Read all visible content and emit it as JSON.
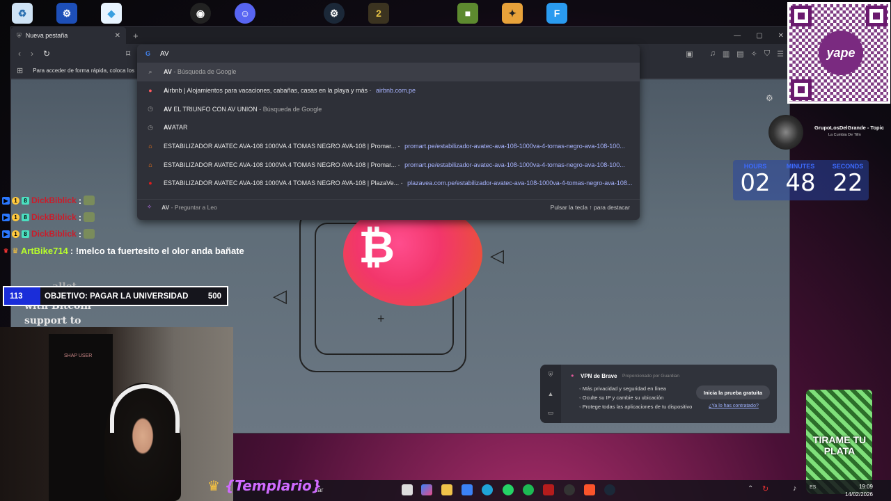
{
  "browser": {
    "tab_title": "Nueva pestaña",
    "omnibox_text": "AV",
    "bookmarks_hint": "Para acceder de forma rápida, coloca los"
  },
  "omnibox": {
    "suggestions": [
      {
        "icon": "search-icon",
        "bold": "AV",
        "text": "",
        "dim": " - Búsqueda de Google",
        "url": ""
      },
      {
        "icon": "airbnb-icon",
        "bold": "A",
        "text": "irbnb | Alojamientos para vacaciones, cabañas, casas en la playa y más",
        "dim": " - ",
        "url": "airbnb.com.pe"
      },
      {
        "icon": "history-icon",
        "bold": "AV",
        "text": " EL TRIUNFO CON AV UNION",
        "dim": " - Búsqueda de Google",
        "url": ""
      },
      {
        "icon": "history-icon",
        "bold": "AV",
        "text": "ATAR",
        "dim": "",
        "url": ""
      },
      {
        "icon": "promart-icon",
        "bold": "",
        "text": "ESTABILIZADOR AVATEC AVA-108 1000VA 4 TOMAS NEGRO AVA-108 | Promar...",
        "dim": "  - ",
        "url": "promart.pe/estabilizador-avatec-ava-108-1000va-4-tomas-negro-ava-108-100..."
      },
      {
        "icon": "promart-icon",
        "bold": "",
        "text": "ESTABILIZADOR AVATEC AVA-108 1000VA 4 TOMAS NEGRO AVA-108 | Promar...",
        "dim": "  - ",
        "url": "promart.pe/estabilizador-avatec-ava-108-1000va-4-tomas-negro-ava-108-100..."
      },
      {
        "icon": "plazavea-icon",
        "bold": "",
        "text": "ESTABILIZADOR AVATEC AVA-108 1000VA 4 TOMAS NEGRO AVA-108 | PlazaVe...",
        "dim": "  - ",
        "url": "plazavea.com.pe/estabilizador-avatec-ava-108-1000va-4-tomas-negro-ava-108..."
      }
    ],
    "leo_bold": "AV",
    "leo_text": " - Preguntar a Leo",
    "leo_hint": "Pulsar la tecla ↑ para destacar"
  },
  "vpn": {
    "title": "VPN de Brave",
    "provided_by": "Proporcionado por Guardian",
    "items": [
      "Más privacidad y seguridad en línea",
      "Oculte su IP y cambie su ubicación",
      "Protege todas las aplicaciones de tu dispositivo"
    ],
    "cta": "Inicia la prueba gratuita",
    "link": "¿Ya lo has contratado?"
  },
  "music": {
    "title": "GrupoLosDelGrande - Topic",
    "subtitle": "La Cumbia De Tilín"
  },
  "timer": {
    "hours_label": "HOURS",
    "hours": "02",
    "minutes_label": "MINUTES",
    "minutes": "48",
    "seconds_label": "SECONDS",
    "seconds": "22"
  },
  "chat": {
    "lines": [
      {
        "user": "DickBiblick",
        "sep": ":"
      },
      {
        "user": "DickBiblick",
        "sep": ":"
      },
      {
        "user": "DickBiblick",
        "sep": ":"
      }
    ],
    "artbike_user": "ArtBike714",
    "artbike_msg": ": !melco ta fuertesito el olor anda bañate"
  },
  "goal": {
    "current": "113",
    "label": "OBJETIVO: PAGAR LA UNIVERSIDAD",
    "target": "500"
  },
  "wallet_text": [
    "with Bitcoin",
    "support to"
  ],
  "wallet_partial": "allet",
  "cam_sign": "SHAP USER",
  "overlay_name": "{Templario}",
  "cup_text": "TIRAME TU PLATA",
  "taskbar": {
    "search_partial": "car",
    "time": "19:09",
    "date": "14/02/2026",
    "lang": "ES"
  },
  "colors": {
    "accent_purple": "#6a1a6e",
    "goal_blue": "#1a2dd9",
    "timer_label": "#3d6bff",
    "chat_user_red": "#c91d2b",
    "chat_user_green": "#b9ff2a"
  }
}
